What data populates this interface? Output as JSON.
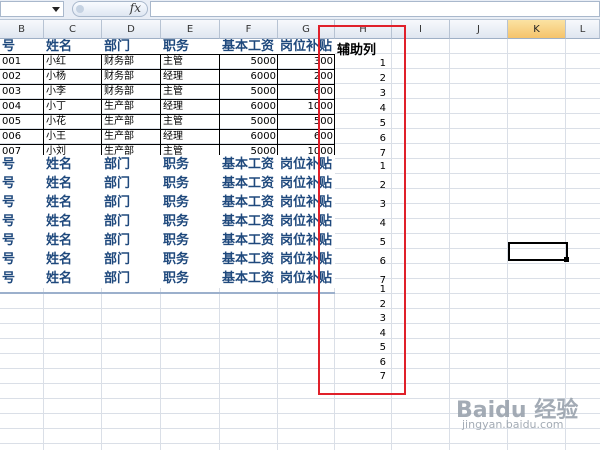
{
  "formula_bar": {
    "name_box_value": "",
    "fx_label": "fx",
    "formula_value": ""
  },
  "columns": [
    {
      "letter": "B"
    },
    {
      "letter": "C"
    },
    {
      "letter": "D"
    },
    {
      "letter": "E"
    },
    {
      "letter": "F"
    },
    {
      "letter": "G"
    },
    {
      "letter": "H"
    },
    {
      "letter": "I"
    },
    {
      "letter": "J"
    },
    {
      "letter": "K"
    },
    {
      "letter": "L"
    }
  ],
  "active_column": "K",
  "header_labels": [
    "工号",
    "姓名",
    "部门",
    "职务",
    "基本工资",
    "岗位补贴"
  ],
  "header_visible": [
    "号",
    "姓名",
    "部门",
    "职务",
    "基本工资",
    "岗位补贴"
  ],
  "aux_header": "辅助列",
  "data_rows": [
    {
      "id": "001",
      "name": "小红",
      "dept": "财务部",
      "title": "主管",
      "base": "5000",
      "allow": "300",
      "aux": "1"
    },
    {
      "id": "002",
      "name": "小杨",
      "dept": "财务部",
      "title": "经理",
      "base": "6000",
      "allow": "200",
      "aux": "2"
    },
    {
      "id": "003",
      "name": "小李",
      "dept": "财务部",
      "title": "主管",
      "base": "5000",
      "allow": "600",
      "aux": "3"
    },
    {
      "id": "004",
      "name": "小丁",
      "dept": "生产部",
      "title": "经理",
      "base": "6000",
      "allow": "1000",
      "aux": "4"
    },
    {
      "id": "005",
      "name": "小花",
      "dept": "生产部",
      "title": "主管",
      "base": "5000",
      "allow": "500",
      "aux": "5"
    },
    {
      "id": "006",
      "name": "小王",
      "dept": "生产部",
      "title": "经理",
      "base": "6000",
      "allow": "600",
      "aux": "6"
    },
    {
      "id": "007",
      "name": "小刘",
      "dept": "生产部",
      "title": "主管",
      "base": "5000",
      "allow": "1000",
      "aux": "7"
    }
  ],
  "repeat_aux": [
    "1",
    "2",
    "3",
    "4",
    "5",
    "6",
    "7"
  ],
  "tail_aux": [
    "1",
    "2",
    "3",
    "4",
    "5",
    "6",
    "7"
  ],
  "watermark": {
    "text": "Baidu 经验",
    "sub": "jingyan.baidu.com"
  },
  "colors": {
    "header_blue": "#1f497d",
    "highlight_red": "#e0202a",
    "active_col": "#f5c36b"
  }
}
